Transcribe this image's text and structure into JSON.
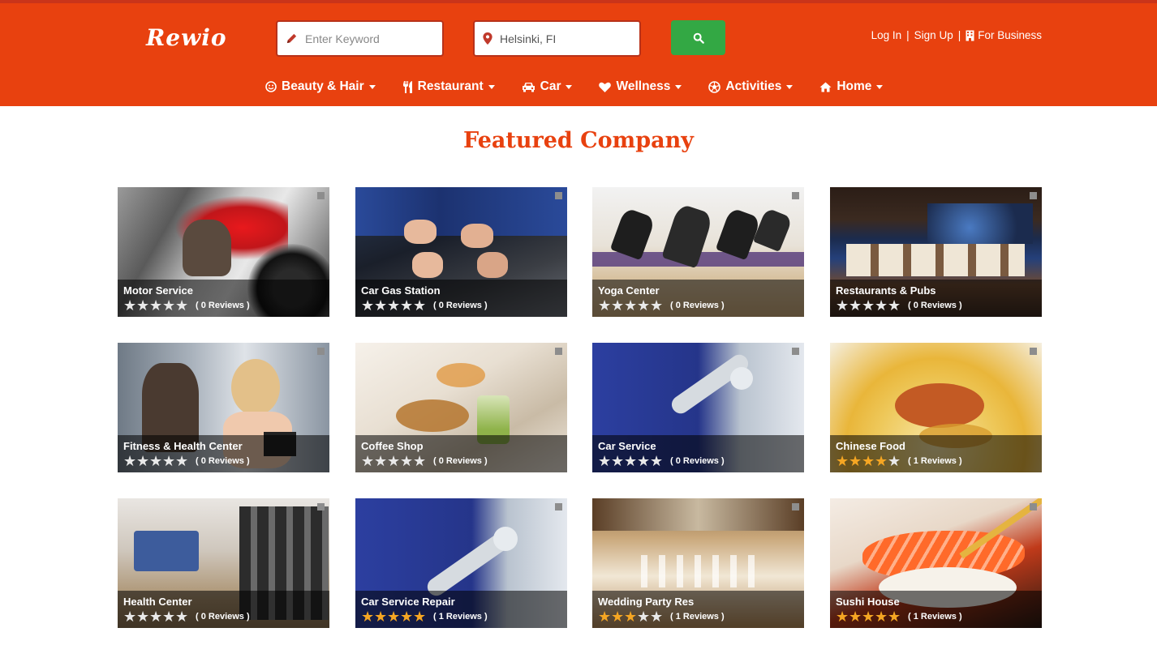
{
  "brand": {
    "logo": "Rewio",
    "accent": "#e8410f",
    "search_button_color": "#33a844"
  },
  "search": {
    "keyword_placeholder": "Enter Keyword",
    "keyword_icon": "pencil-icon",
    "location_value": "Helsinki, FI",
    "location_icon": "map-marker-icon",
    "submit_icon": "search-icon"
  },
  "account": {
    "login": "Log In",
    "separator": "|",
    "signup": "Sign Up",
    "business": "For Business",
    "business_icon": "building-icon"
  },
  "nav": [
    {
      "label": "Beauty & Hair",
      "icon": "smile-icon"
    },
    {
      "label": "Restaurant",
      "icon": "cutlery-icon"
    },
    {
      "label": "Car",
      "icon": "car-icon"
    },
    {
      "label": "Wellness",
      "icon": "heart-icon"
    },
    {
      "label": "Activities",
      "icon": "soccer-ball-icon"
    },
    {
      "label": "Home",
      "icon": "home-icon"
    }
  ],
  "featured": {
    "heading": "Featured Company",
    "companies": [
      {
        "name": "Motor Service",
        "rating": 0,
        "reviews": "( 0 Reviews )"
      },
      {
        "name": "Car Gas Station",
        "rating": 0,
        "reviews": "( 0 Reviews )"
      },
      {
        "name": "Yoga Center",
        "rating": 0,
        "reviews": "( 0 Reviews )"
      },
      {
        "name": "Restaurants & Pubs",
        "rating": 0,
        "reviews": "( 0 Reviews )"
      },
      {
        "name": "Fitness & Health Center",
        "rating": 0,
        "reviews": "( 0 Reviews )"
      },
      {
        "name": "Coffee Shop",
        "rating": 0,
        "reviews": "( 0 Reviews )"
      },
      {
        "name": "Car Service",
        "rating": 0,
        "reviews": "( 0 Reviews )"
      },
      {
        "name": "Chinese Food",
        "rating": 4,
        "reviews": "( 1 Reviews )"
      },
      {
        "name": "Health Center",
        "rating": 0,
        "reviews": "( 0 Reviews )"
      },
      {
        "name": "Car Service Repair",
        "rating": 5,
        "reviews": "( 1 Reviews )"
      },
      {
        "name": "Wedding Party Res",
        "rating": 3,
        "reviews": "( 1 Reviews )"
      },
      {
        "name": "Sushi House",
        "rating": 5,
        "reviews": "( 1 Reviews )"
      }
    ]
  }
}
